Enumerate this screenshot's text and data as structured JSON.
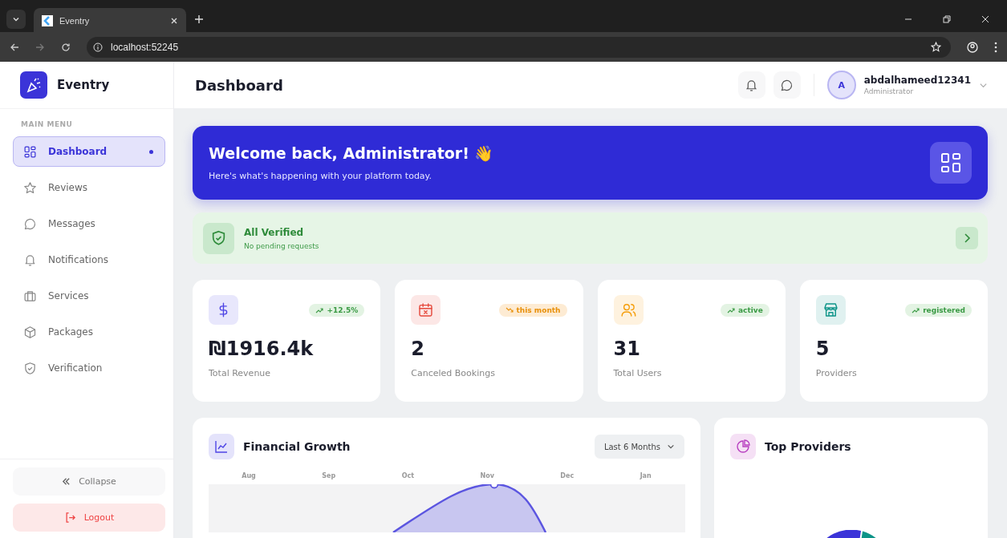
{
  "browser": {
    "tab_title": "Eventry",
    "url": "localhost:52245"
  },
  "sidebar": {
    "brand": "Eventry",
    "section_label": "MAIN MENU",
    "items": [
      {
        "label": "Dashboard",
        "selected": true
      },
      {
        "label": "Reviews",
        "selected": false
      },
      {
        "label": "Messages",
        "selected": false
      },
      {
        "label": "Notifications",
        "selected": false
      },
      {
        "label": "Services",
        "selected": false
      },
      {
        "label": "Packages",
        "selected": false
      },
      {
        "label": "Verification",
        "selected": false
      }
    ],
    "collapse_label": "Collapse",
    "logout_label": "Logout"
  },
  "header": {
    "title": "Dashboard",
    "user": {
      "initial": "A",
      "name": "abdalhameed12341",
      "role": "Administrator"
    }
  },
  "banner": {
    "title": "Welcome back, Administrator! 👋",
    "subtitle": "Here's what's happening with your platform today."
  },
  "verification": {
    "title": "All Verified",
    "subtitle": "No pending requests"
  },
  "stats": [
    {
      "badge": "+12.5%",
      "value": "₪1916.4k",
      "label": "Total Revenue"
    },
    {
      "badge": "this month",
      "value": "2",
      "label": "Canceled Bookings"
    },
    {
      "badge": "active",
      "value": "31",
      "label": "Total Users"
    },
    {
      "badge": "registered",
      "value": "5",
      "label": "Providers"
    }
  ],
  "financial": {
    "title": "Financial Growth",
    "period": "Last 6 Months",
    "months": [
      "Aug",
      "Sep",
      "Oct",
      "Nov",
      "Dec",
      "Jan"
    ]
  },
  "providers": {
    "title": "Top Providers"
  }
}
